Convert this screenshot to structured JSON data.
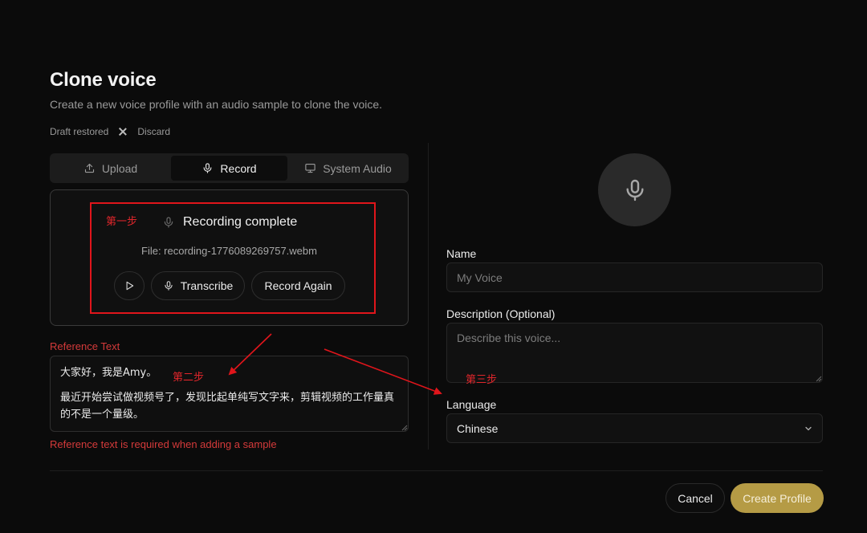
{
  "header": {
    "title": "Clone voice",
    "subtitle": "Create a new voice profile with an audio sample to clone the voice.",
    "draft_status": "Draft restored",
    "discard_label": "Discard"
  },
  "tabs": [
    {
      "label": "Upload",
      "icon": "upload-icon",
      "active": false
    },
    {
      "label": "Record",
      "icon": "microphone-icon",
      "active": true
    },
    {
      "label": "System Audio",
      "icon": "monitor-icon",
      "active": false
    }
  ],
  "recording": {
    "status": "Recording complete",
    "file_text": "File: recording-1776089269757.webm",
    "play_icon": "play-icon",
    "transcribe_label": "Transcribe",
    "record_again_label": "Record Again"
  },
  "reference": {
    "label": "Reference Text",
    "line1": "大家好，我是Amy。",
    "line2": "最近开始尝试做视频号了，发现比起单纯写文字来，剪辑视频的工作量真的不是一个量级。",
    "error": "Reference text is required when adding a sample"
  },
  "annotations": {
    "step1": "第一步",
    "step2": "第二步",
    "step3": "第三步",
    "color": "#e0151b"
  },
  "form": {
    "name_label": "Name",
    "name_placeholder": "My Voice",
    "description_label": "Description (Optional)",
    "description_placeholder": "Describe this voice...",
    "language_label": "Language",
    "language_value": "Chinese"
  },
  "footer": {
    "cancel_label": "Cancel",
    "create_label": "Create Profile"
  },
  "colors": {
    "background": "#0b0b0b",
    "accent": "#b59b45",
    "error": "#d43a3a"
  }
}
